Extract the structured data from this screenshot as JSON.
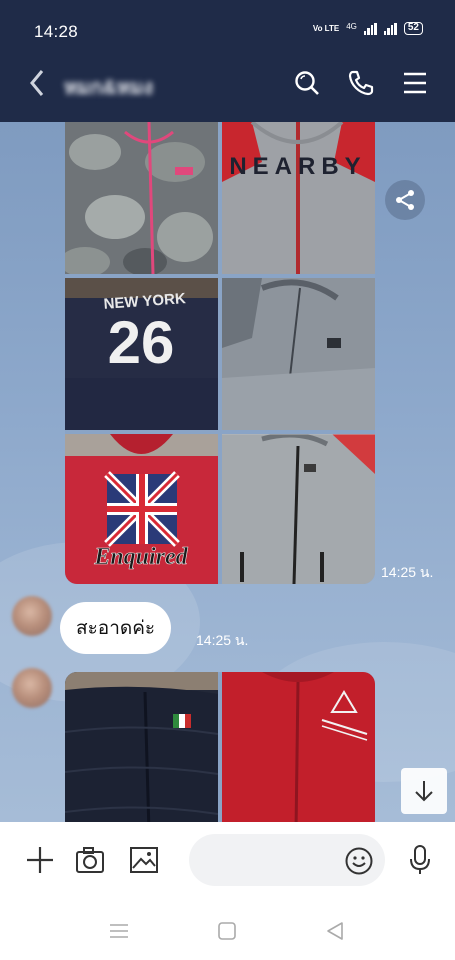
{
  "status_bar": {
    "time": "14:28",
    "network": "4G",
    "volte": "Vo LTE",
    "battery": "52"
  },
  "header": {
    "title": "หมก&หมง",
    "icons": [
      "back-icon",
      "search-icon",
      "phone-icon",
      "menu-icon"
    ]
  },
  "messages": [
    {
      "type": "photo-grid",
      "time": "14:25 น.",
      "photos": 6,
      "print_texts": [
        "NEARBY",
        "NEW YORK",
        "26",
        "Enquired"
      ]
    },
    {
      "type": "text",
      "text": "สะอาดค่ะ",
      "time": "14:25 น."
    },
    {
      "type": "photo-grid",
      "photos": 2
    }
  ],
  "composer": {
    "placeholder": "",
    "tools": [
      "plus-icon",
      "camera-icon",
      "image-icon",
      "emoji-icon",
      "mic-icon"
    ]
  },
  "colors": {
    "header_bg": "#1f2b48",
    "chat_bg": "#8da8cb",
    "bubble_bg": "#ffffff"
  }
}
